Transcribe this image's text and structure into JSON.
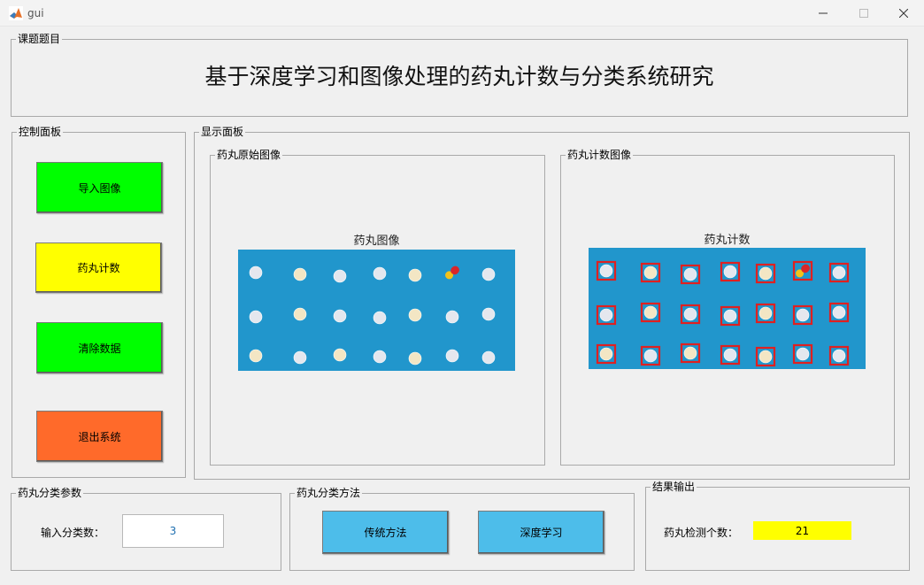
{
  "window": {
    "title": "gui",
    "app_icon": "matlab-icon",
    "minimize_icon": "minimize-icon",
    "maximize_icon": "maximize-icon",
    "close_icon": "close-icon"
  },
  "topic_panel": {
    "label": "课题题目",
    "title": "基于深度学习和图像处理的药丸计数与分类系统研究"
  },
  "control_panel": {
    "label": "控制面板",
    "buttons": [
      {
        "label": "导入图像",
        "color": "#00ff00"
      },
      {
        "label": "药丸计数",
        "color": "#ffff00"
      },
      {
        "label": "清除数据",
        "color": "#00ff00"
      },
      {
        "label": "退出系统",
        "color": "#ff6a2a"
      }
    ]
  },
  "display_panel": {
    "label": "显示面板",
    "original": {
      "label": "药丸原始图像",
      "axes_title": "药丸图像"
    },
    "counted": {
      "label": "药丸计数图像",
      "axes_title": "药丸计数"
    },
    "image_colors": {
      "background": "#2196cc",
      "box": "#e02020"
    }
  },
  "params_panel": {
    "label": "药丸分类参数",
    "input_label": "输入分类数：",
    "input_value": "3"
  },
  "method_panel": {
    "label": "药丸分类方法",
    "buttons": [
      {
        "label": "传统方法",
        "color": "#4dbdea"
      },
      {
        "label": "深度学习",
        "color": "#4dbdea"
      }
    ]
  },
  "result_panel": {
    "label": "结果输出",
    "count_label": "药丸检测个数：",
    "count_value": "21",
    "count_color": "#ffff00"
  }
}
